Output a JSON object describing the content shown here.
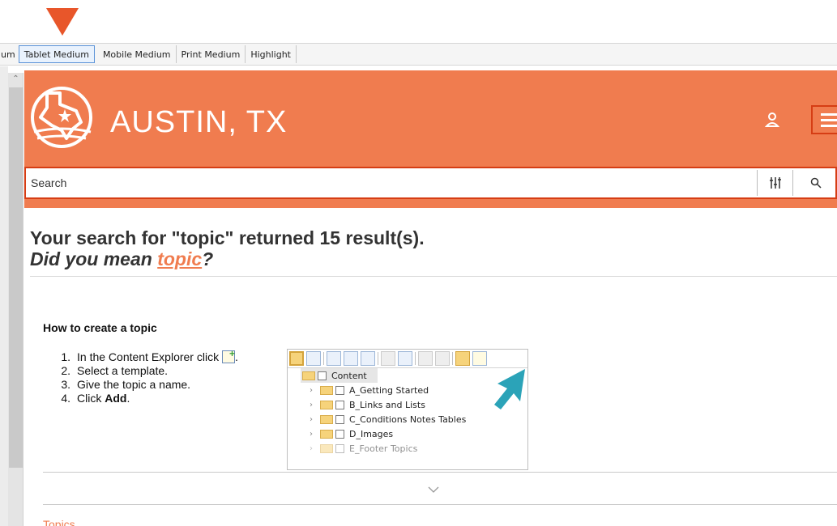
{
  "tabbar": {
    "tabs": [
      {
        "label": "um",
        "active": false
      },
      {
        "label": "Tablet Medium",
        "active": true
      },
      {
        "label": "Mobile Medium",
        "active": false
      },
      {
        "label": "Print Medium",
        "active": false
      },
      {
        "label": "Highlight",
        "active": false
      }
    ]
  },
  "header": {
    "title": "AUSTIN, TX",
    "color": "#f07c4f",
    "accent": "#d63d14"
  },
  "search": {
    "placeholder": "Search"
  },
  "results": {
    "heading": "Your search for \"topic\" returned 15 result(s).",
    "did_you_mean_prefix": "Did you mean ",
    "did_you_mean_link": "topic",
    "did_you_mean_suffix": "?"
  },
  "card": {
    "title": "How to create a topic",
    "steps": [
      {
        "n": "1.",
        "text": "In the Content Explorer click",
        "icon": "new-topic-icon",
        "after": "."
      },
      {
        "n": "2.",
        "text": "Select a template."
      },
      {
        "n": "3.",
        "text": "Give the topic a name."
      },
      {
        "n": "4.",
        "text": "Click ",
        "bold": "Add",
        "after": "."
      }
    ],
    "explorer": {
      "root": "Content",
      "folders": [
        "A_Getting Started",
        "B_Links and Lists",
        "C_Conditions Notes Tables",
        "D_Images",
        "E_Footer Topics"
      ]
    }
  },
  "footer": {
    "topics_link": "Topics"
  },
  "colors": {
    "callout_arrow": "#e8562a",
    "teal_arrow": "#2ba3b8"
  }
}
